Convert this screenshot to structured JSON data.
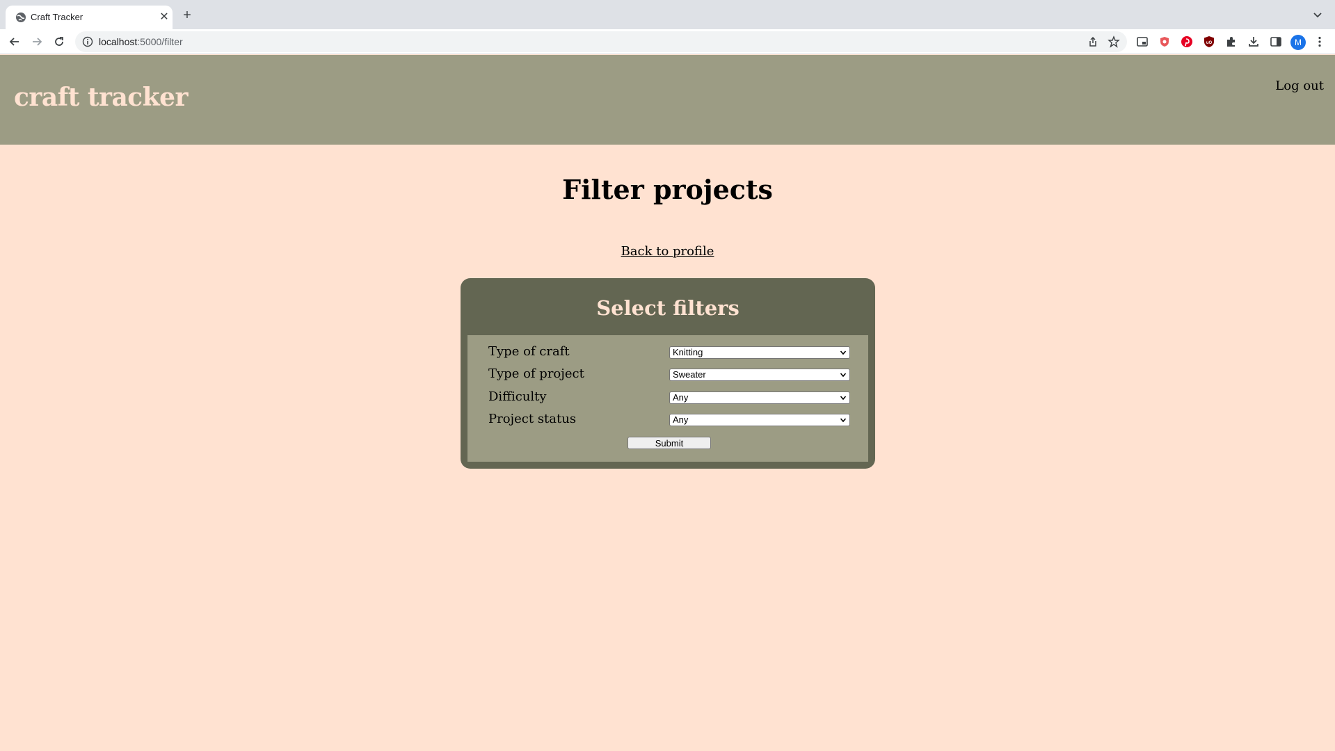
{
  "browser": {
    "tab_title": "Craft Tracker",
    "url_host": "localhost",
    "url_path": ":5000/filter",
    "avatar_letter": "M"
  },
  "header": {
    "brand": "craft tracker",
    "logout_label": "Log out"
  },
  "main": {
    "title": "Filter projects",
    "back_link": "Back to profile"
  },
  "filters": {
    "title": "Select filters",
    "rows": [
      {
        "label": "Type of craft",
        "value": "Knitting"
      },
      {
        "label": "Type of project",
        "value": "Sweater"
      },
      {
        "label": "Difficulty",
        "value": "Any"
      },
      {
        "label": "Project status",
        "value": "Any"
      }
    ],
    "submit_label": "Submit"
  },
  "colors": {
    "page_bg": "#ffe2d1",
    "header_bg": "#9c9c84",
    "card_bg": "#636652",
    "accent_text": "#ffe2d1"
  }
}
